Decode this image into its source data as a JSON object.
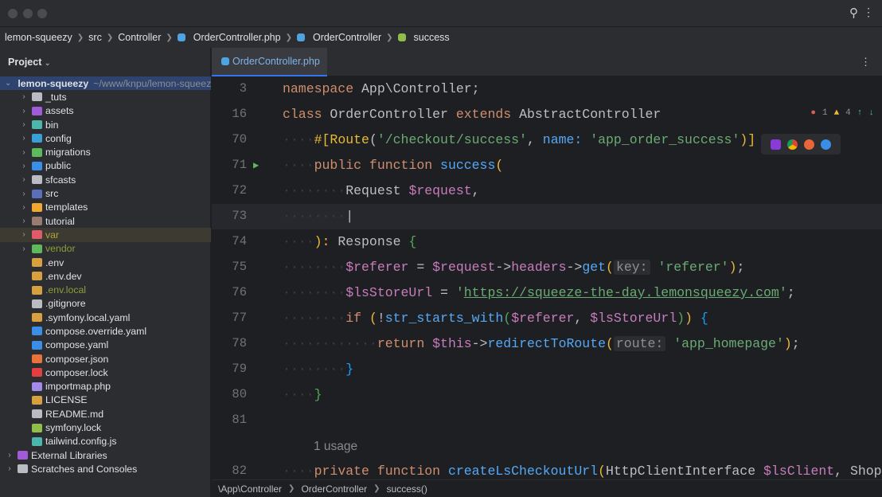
{
  "breadcrumb": [
    "lemon-squeezy",
    "src",
    "Controller",
    "OrderController.php",
    "OrderController",
    "success"
  ],
  "sidebar": {
    "title": "Project",
    "items": [
      {
        "label": "lemon-squeezy",
        "extra": "~/www/knpu/lemon-squeezy",
        "color": "#a28be8",
        "chev": "v",
        "depth": 0,
        "sel": true,
        "bold": true
      },
      {
        "label": "_tuts",
        "color": "#b9bcc2",
        "chev": ">",
        "depth": 1
      },
      {
        "label": "assets",
        "color": "#a05cd6",
        "chev": ">",
        "depth": 1
      },
      {
        "label": "bin",
        "color": "#4db6ac",
        "chev": ">",
        "depth": 1
      },
      {
        "label": "config",
        "color": "#3a9fd6",
        "chev": ">",
        "depth": 1
      },
      {
        "label": "migrations",
        "color": "#5fb85c",
        "chev": ">",
        "depth": 1
      },
      {
        "label": "public",
        "color": "#3a8ee6",
        "chev": ">",
        "depth": 1
      },
      {
        "label": "sfcasts",
        "color": "#b9bcc2",
        "chev": ">",
        "depth": 1
      },
      {
        "label": "src",
        "color": "#5a6fb8",
        "chev": ">",
        "depth": 1
      },
      {
        "label": "templates",
        "color": "#f0a832",
        "chev": ">",
        "depth": 1
      },
      {
        "label": "tutorial",
        "color": "#9a7b72",
        "chev": ">",
        "depth": 1
      },
      {
        "label": "var",
        "color": "#e05b6a",
        "chev": ">",
        "depth": 1,
        "hl": true,
        "text": "#b0a33a"
      },
      {
        "label": "vendor",
        "color": "#5fb85c",
        "chev": ">",
        "depth": 1,
        "text": "#8f9c3a"
      },
      {
        "label": ".env",
        "color": "#d6a040",
        "depth": 1
      },
      {
        "label": ".env.dev",
        "color": "#d6a040",
        "depth": 1
      },
      {
        "label": ".env.local",
        "color": "#d6a040",
        "depth": 1,
        "text": "#8f9c3a"
      },
      {
        "label": ".gitignore",
        "color": "#b9bcc2",
        "depth": 1
      },
      {
        "label": ".symfony.local.yaml",
        "color": "#d6a040",
        "depth": 1
      },
      {
        "label": "compose.override.yaml",
        "color": "#3a8ee6",
        "depth": 1
      },
      {
        "label": "compose.yaml",
        "color": "#3a8ee6",
        "depth": 1
      },
      {
        "label": "composer.json",
        "color": "#e8733a",
        "depth": 1
      },
      {
        "label": "composer.lock",
        "color": "#e04040",
        "depth": 1
      },
      {
        "label": "importmap.php",
        "color": "#a28be8",
        "depth": 1
      },
      {
        "label": "LICENSE",
        "color": "#d6a040",
        "depth": 1
      },
      {
        "label": "README.md",
        "color": "#b9bcc2",
        "depth": 1
      },
      {
        "label": "symfony.lock",
        "color": "#8fbf4a",
        "depth": 1
      },
      {
        "label": "tailwind.config.js",
        "color": "#4db6ac",
        "depth": 1
      },
      {
        "label": "External Libraries",
        "color": "#a05cd6",
        "chev": ">",
        "depth": 0
      },
      {
        "label": "Scratches and Consoles",
        "color": "#b9bcc2",
        "chev": ">",
        "depth": 0
      }
    ]
  },
  "editor": {
    "tab": "OrderController.php",
    "errors": "1",
    "warnings": "4",
    "usage": "1 usage",
    "lines": [
      {
        "n": "3",
        "t": [
          [
            "namespace ",
            "kw"
          ],
          [
            "App\\Controller;",
            "pn"
          ]
        ]
      },
      {
        "n": "16",
        "t": [
          [
            "class ",
            "kw"
          ],
          [
            "OrderController ",
            "pn"
          ],
          [
            "extends ",
            "kw"
          ],
          [
            "AbstractController",
            "pn"
          ]
        ]
      },
      {
        "n": "70",
        "t": [
          [
            "····",
            "dots"
          ],
          [
            "#[",
            "yl"
          ],
          [
            "Route",
            "yl"
          ],
          [
            "(",
            "pn"
          ],
          [
            "'/checkout/success'",
            "str"
          ],
          [
            ", ",
            "pn"
          ],
          [
            "name: ",
            "fn"
          ],
          [
            "'app_order_success'",
            "str"
          ],
          [
            ")]",
            "yl"
          ]
        ]
      },
      {
        "n": "71",
        "t": [
          [
            "····",
            "dots"
          ],
          [
            "public function ",
            "kw"
          ],
          [
            "success",
            "nm"
          ],
          [
            "(",
            "yl"
          ]
        ]
      },
      {
        "n": "72",
        "t": [
          [
            "········",
            "dots"
          ],
          [
            "Request ",
            "ty"
          ],
          [
            "$request",
            "var"
          ],
          [
            ",",
            "pn"
          ]
        ]
      },
      {
        "n": "73",
        "t": [
          [
            "········",
            "dots"
          ],
          [
            "|",
            "pn"
          ]
        ],
        "cur": true
      },
      {
        "n": "74",
        "t": [
          [
            "····",
            "dots"
          ],
          [
            "): ",
            "yl"
          ],
          [
            "Response ",
            "ty"
          ],
          [
            "{",
            "gr"
          ]
        ]
      },
      {
        "n": "75",
        "t": [
          [
            "········",
            "dots"
          ],
          [
            "$referer",
            "var"
          ],
          [
            " = ",
            "pn"
          ],
          [
            "$request",
            "var"
          ],
          [
            "->",
            "pn"
          ],
          [
            "headers",
            "var"
          ],
          [
            "->",
            "pn"
          ],
          [
            "get",
            "nm"
          ],
          [
            "(",
            "yl"
          ],
          [
            "key:",
            "hint"
          ],
          [
            " 'referer'",
            "str"
          ],
          [
            ")",
            "yl"
          ],
          [
            ";",
            "pn"
          ]
        ]
      },
      {
        "n": "76",
        "t": [
          [
            "········",
            "dots"
          ],
          [
            "$lsStoreUrl",
            "var"
          ],
          [
            " = ",
            "pn"
          ],
          [
            "'",
            "str"
          ],
          [
            "https://squeeze-the-day.lemonsqueezy.com",
            "url"
          ],
          [
            "'",
            "str"
          ],
          [
            ";",
            "pn"
          ]
        ]
      },
      {
        "n": "77",
        "t": [
          [
            "········",
            "dots"
          ],
          [
            "if ",
            "kw"
          ],
          [
            "(",
            "yl"
          ],
          [
            "!",
            "pn"
          ],
          [
            "str_starts_with",
            "nm"
          ],
          [
            "(",
            "gr"
          ],
          [
            "$referer",
            "var"
          ],
          [
            ", ",
            "pn"
          ],
          [
            "$lsStoreUrl",
            "var"
          ],
          [
            ")",
            "gr"
          ],
          [
            ") ",
            "yl"
          ],
          [
            "{",
            "bl"
          ]
        ]
      },
      {
        "n": "78",
        "t": [
          [
            "············",
            "dots"
          ],
          [
            "return ",
            "kw"
          ],
          [
            "$this",
            "var"
          ],
          [
            "->",
            "pn"
          ],
          [
            "redirectToRoute",
            "nm"
          ],
          [
            "(",
            "yl"
          ],
          [
            "route:",
            "hint"
          ],
          [
            " 'app_homepage'",
            "str"
          ],
          [
            ")",
            "yl"
          ],
          [
            ";",
            "pn"
          ]
        ]
      },
      {
        "n": "79",
        "t": [
          [
            "········",
            "dots"
          ],
          [
            "}",
            "bl"
          ]
        ]
      },
      {
        "n": "80",
        "t": [
          [
            "····",
            "dots"
          ],
          [
            "}",
            "gr"
          ]
        ]
      },
      {
        "n": "81",
        "t": []
      },
      {
        "n": "82",
        "t": [
          [
            "····",
            "dots"
          ],
          [
            "private function ",
            "kw"
          ],
          [
            "createLsCheckoutUrl",
            "nm"
          ],
          [
            "(",
            "yl"
          ],
          [
            "HttpClientInterface ",
            "ty"
          ],
          [
            "$lsClient",
            "var"
          ],
          [
            ", Shop",
            "pn"
          ]
        ],
        "gap": true
      }
    ]
  },
  "statusbar": [
    "\\App\\Controller",
    "OrderController",
    "success()"
  ]
}
